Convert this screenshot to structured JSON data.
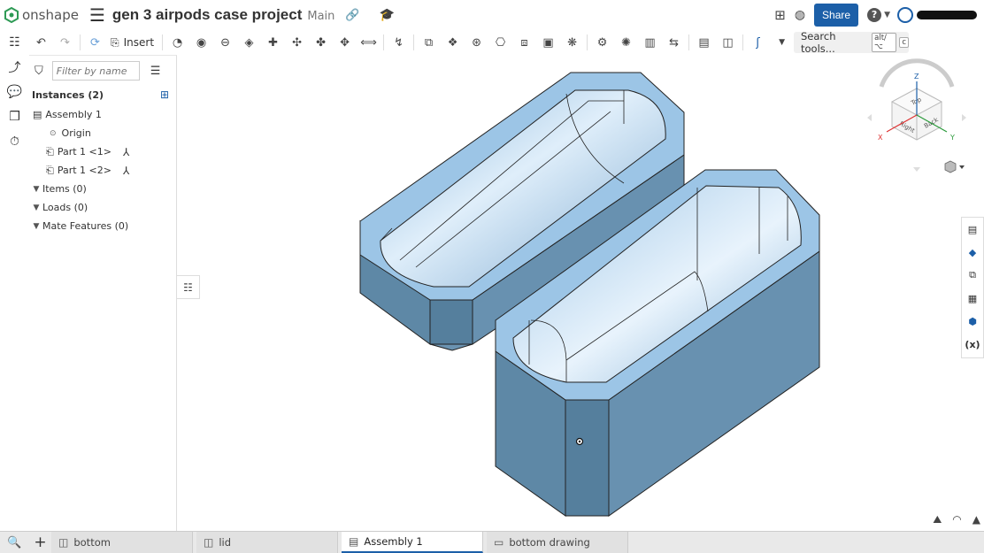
{
  "header": {
    "brand": "onshape",
    "doc_title": "gen 3 airpods case project",
    "branch": "Main",
    "share_label": "Share",
    "help_label": "?"
  },
  "toolbar": {
    "insert_label": "Insert",
    "search_label": "Search tools...",
    "shortcut_key1": "alt/⌥",
    "shortcut_key2": "c"
  },
  "panel": {
    "filter_placeholder": "Filter by name",
    "instances_label": "Instances (2)",
    "tree": {
      "assembly": "Assembly 1",
      "origin": "Origin",
      "part1": "Part 1 <1>",
      "part2": "Part 1 <2>",
      "items": "Items (0)",
      "loads": "Loads (0)",
      "mate_features": "Mate Features (0)"
    }
  },
  "viewcube": {
    "top": "Top",
    "right": "Right",
    "back": "Back",
    "x": "X",
    "y": "Y",
    "z": "Z"
  },
  "tabs": [
    {
      "label": "bottom",
      "active": false
    },
    {
      "label": "lid",
      "active": false
    },
    {
      "label": "Assembly 1",
      "active": true
    },
    {
      "label": "bottom drawing",
      "active": false
    }
  ],
  "colors": {
    "accent": "#1c5fa8",
    "part_face_top": "#9cc5e6",
    "part_face_side": "#5e8aa8"
  }
}
